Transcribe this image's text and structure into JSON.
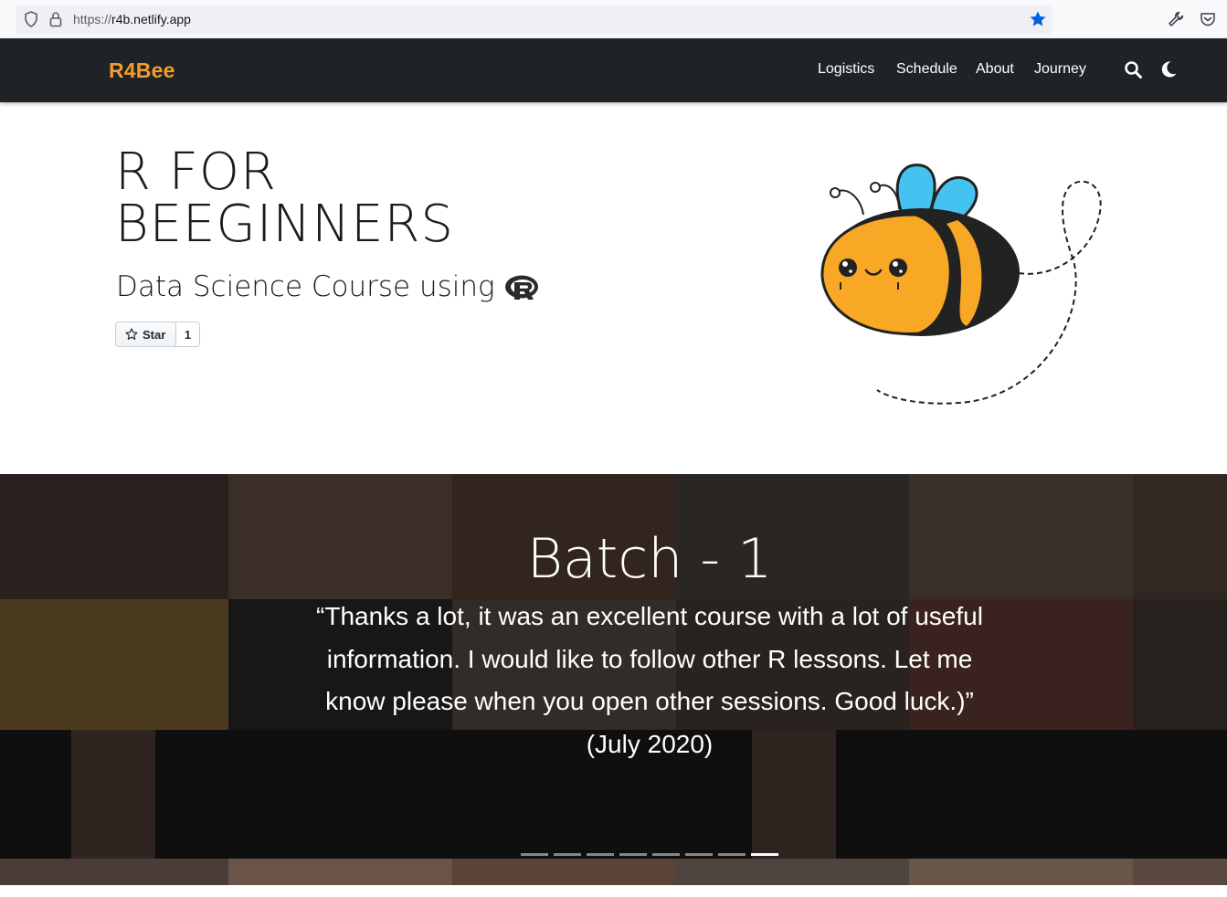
{
  "browser": {
    "url_scheme": "https://",
    "url_host": "r4b.netlify.app"
  },
  "navbar": {
    "brand": "R4Bee",
    "links": [
      "Logistics",
      "Schedule",
      "About",
      "Journey"
    ]
  },
  "hero": {
    "title_line1": "R FOR",
    "title_line2": "BEEGINNERS",
    "subtitle": "Data Science Course using",
    "star_label": "Star",
    "star_count": "1"
  },
  "carousel": {
    "title": "Batch - 1",
    "quote_line1": "“Thanks a lot, it was an excellent course with a lot of useful",
    "quote_line2": "information. I would like to follow other R lessons. Let me",
    "quote_line3": "know please when you open other sessions. Good luck.)”",
    "quote_date": "(July 2020)",
    "slide_count": 8,
    "active_slide": 8
  },
  "colors": {
    "brand_orange": "#f39c2b",
    "navbar_bg": "#1f2326",
    "bookmark_blue": "#0061e0",
    "bee_yellow": "#f9a825",
    "bee_wing": "#45c3f0"
  }
}
